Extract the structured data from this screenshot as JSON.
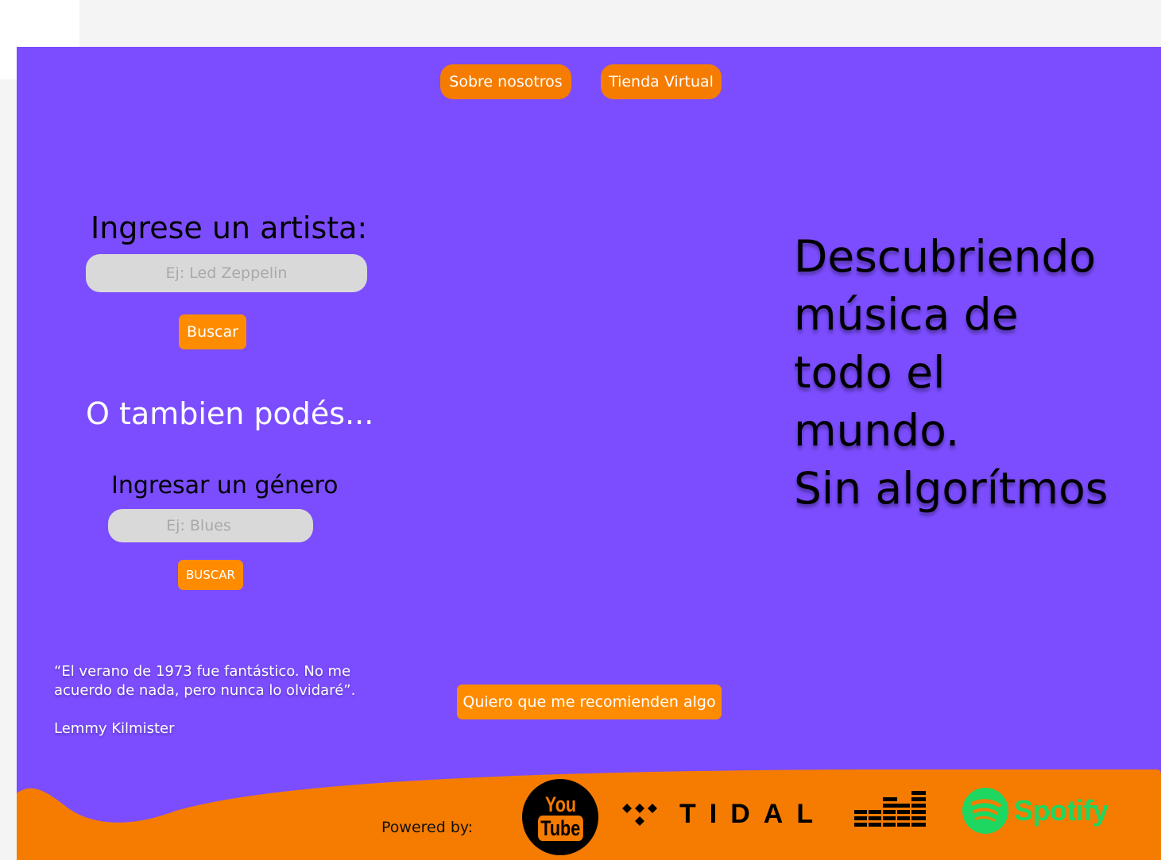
{
  "nav": {
    "about_label": "Sobre nosotros",
    "store_label": "Tienda Virtual"
  },
  "artist_search": {
    "title": "Ingrese un artista:",
    "placeholder": "Ej: Led Zeppelin",
    "button_label": "Buscar"
  },
  "alternative": {
    "title": "O tambien podés..."
  },
  "genre_search": {
    "title": "Ingresar un género",
    "placeholder": "Ej: Blues",
    "button_label": "BUSCAR"
  },
  "headline": {
    "lines": [
      "Descubriendo",
      "música de",
      "todo el",
      "mundo.",
      "Sin algorítmos"
    ]
  },
  "quote": {
    "text_line1": "“El verano de 1973 fue fantástico. No me",
    "text_line2": "acuerdo de nada, pero nunca lo olvidaré”.",
    "author": "Lemmy Kilmister"
  },
  "recommend": {
    "button_label": "Quiero que me recomienden algo"
  },
  "footer": {
    "powered_by": "Powered by:",
    "logos": {
      "youtube_you": "You",
      "youtube_tube": "Tube",
      "tidal": "TIDAL",
      "spotify": "Spotify"
    }
  },
  "colors": {
    "background": "#7c4dff",
    "accent": "#f57c00",
    "button": "#ff8c00",
    "spotify_green": "#1ed760"
  }
}
